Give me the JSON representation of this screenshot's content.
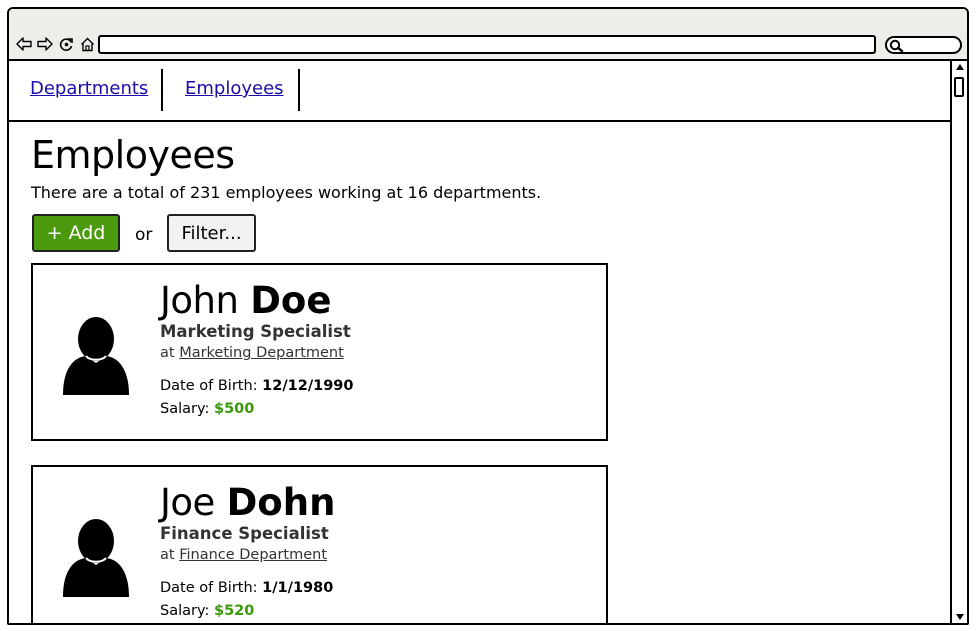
{
  "nav": {
    "links": [
      "Departments",
      "Employees"
    ]
  },
  "header": {
    "title": "Employees",
    "summary": "There are a total of 231 employees working at 16 departments."
  },
  "actions": {
    "add_label": "+ Add",
    "or_label": "or",
    "filter_label": "Filter..."
  },
  "employees": [
    {
      "first_name": "John",
      "last_name": "Doe",
      "role": "Marketing Specialist",
      "at_label": "at",
      "department": "Marketing Department",
      "dob_label": "Date of Birth:",
      "dob": "12/12/1990",
      "salary_label": "Salary:",
      "salary": "$500"
    },
    {
      "first_name": "Joe",
      "last_name": "Dohn",
      "role": "Finance Specialist",
      "at_label": "at",
      "department": "Finance Department",
      "dob_label": "Date of Birth:",
      "dob": "1/1/1980",
      "salary_label": "Salary:",
      "salary": "$520"
    }
  ],
  "colors": {
    "add_button": "#4b9a0d",
    "salary": "#3a9a0a",
    "link": "#1a0dab",
    "chrome": "#efedea"
  },
  "icons": [
    "back-icon",
    "forward-icon",
    "reload-icon",
    "home-icon",
    "search-icon",
    "avatar-icon",
    "scroll-up-icon",
    "scroll-down-icon"
  ]
}
